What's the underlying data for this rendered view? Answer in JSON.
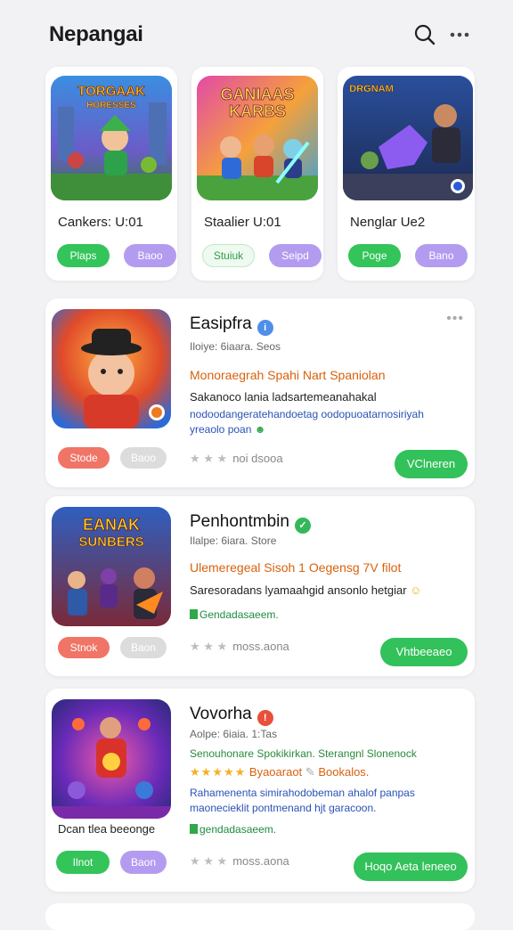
{
  "header": {
    "title": "Nepangai",
    "search_icon": "search-icon",
    "more_icon": "more-dots-icon"
  },
  "featured": [
    {
      "thumb_text": "TORGAAK HORESSES",
      "name": "Cankers: U:01",
      "btn1": "Plaps",
      "btn2": "Baoo"
    },
    {
      "thumb_text": "GANIAAS KARBS",
      "name": "Staalier U:01",
      "btn1": "Stuiuk",
      "btn2": "Seipd"
    },
    {
      "thumb_text": "DRGNAM",
      "name": "Nenglar Ue2",
      "btn1": "Poge",
      "btn2": "Bano"
    }
  ],
  "list": [
    {
      "title": "Easipfra",
      "meta": "Iloiye: 6iaara.  Seos",
      "headline": "Monoraegrah Spahi Nart Spaniolan",
      "desc": "Sakanoco lania ladsartemeanahakal",
      "blue": "nodoodangeratehandoetag oodopuoatarnosiriyah",
      "blue2": "yreaolo poan",
      "btn_left": "Stode",
      "btn_mid": "Baoo",
      "rating": "noi dsooa",
      "action": "VClneren"
    },
    {
      "title": "Penhontmbin",
      "meta": "Ilalpe: 6iara.  Store",
      "headline": "Ulemeregeal Sisoh 1 Oegensg 7V filot",
      "desc": "Saresoradans lyamaahgid ansonlo hetgiar",
      "green": "Gendadasaeem.",
      "btn_left": "Stnok",
      "btn_mid": "Baon",
      "rating": "moss.aona",
      "action": "Vhtbeeaeo",
      "thumb_text": "EANAK SUNBERS"
    },
    {
      "title": "Vovorha",
      "meta": "Aolpe: 6iaia.  1:Tas",
      "headline": "Senouhonare Spokikirkan. Sterangnl Slonenock",
      "stars_text": "Byaoaraot",
      "stars_text2": "Bookalos.",
      "blue": "Rahamenenta simirahodobeman ahalof panpas",
      "blue2": "maonecieklit  pontmenand hjt garacoon.",
      "caption": "Dcan tlea beeonge",
      "green": "gendadasaeem.",
      "btn_left": "Ilnot",
      "btn_mid": "Baon",
      "rating": "moss.aona",
      "action": "Hoqo Aeta leneeo"
    }
  ],
  "colors": {
    "accent_green": "#32c15a",
    "purple": "#b39cf0",
    "red": "#f07567",
    "orange_text": "#d8610c",
    "blue_text": "#2a52b5"
  }
}
